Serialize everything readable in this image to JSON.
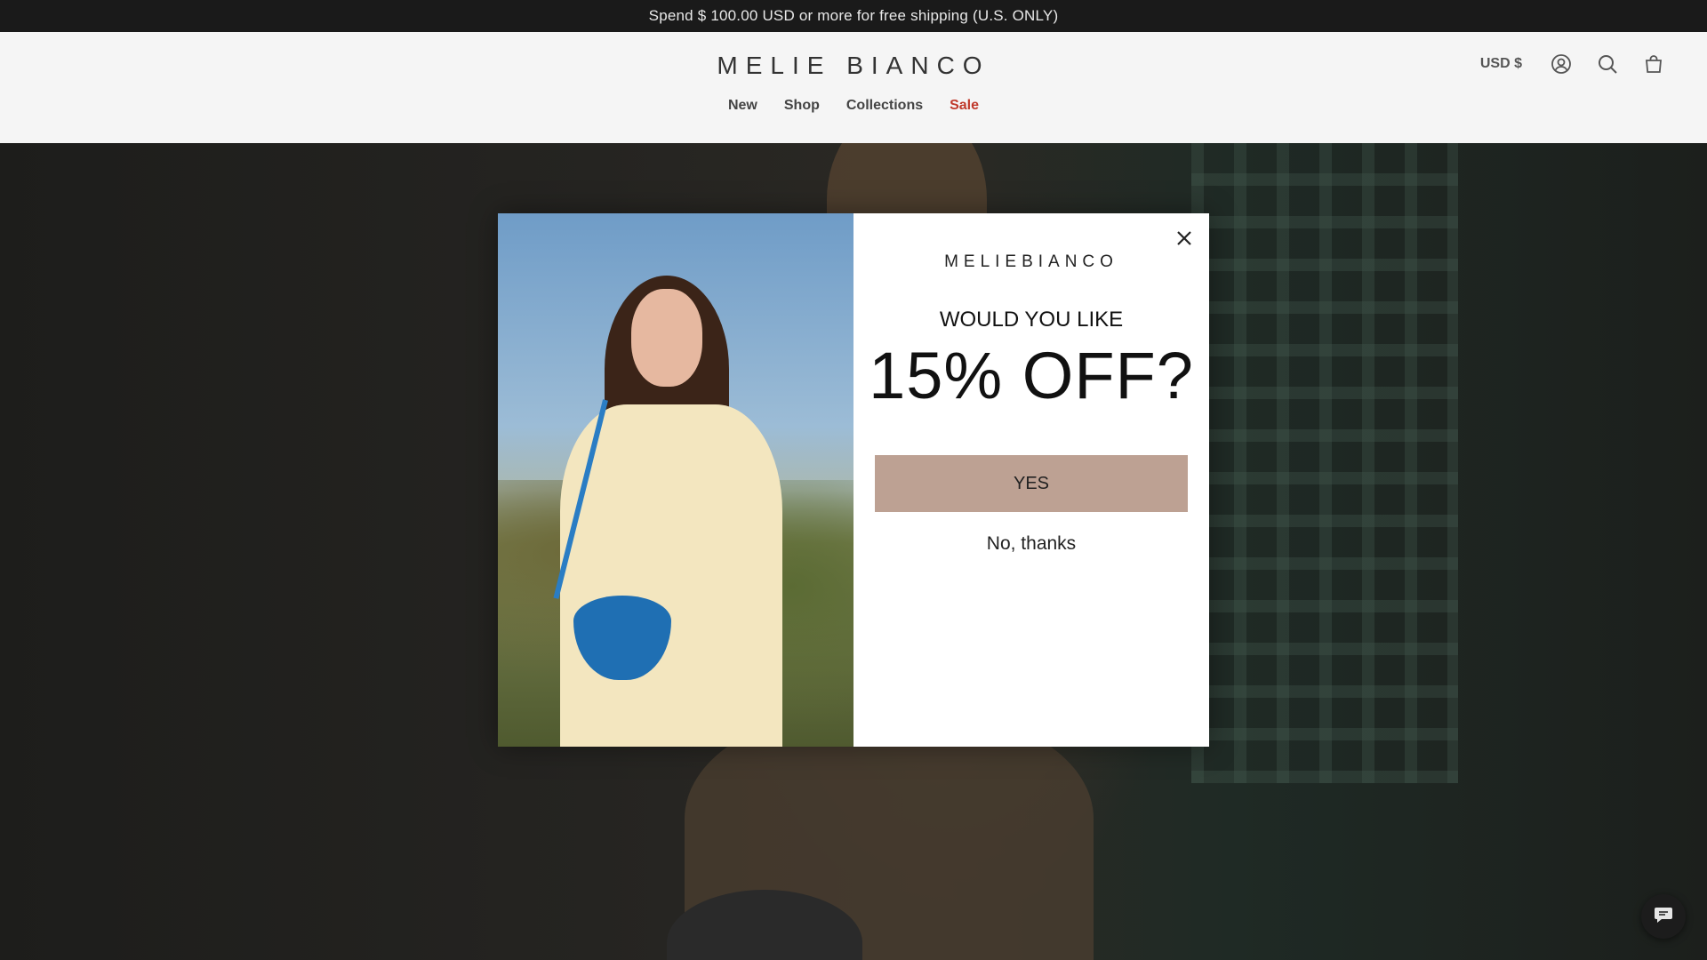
{
  "announcement": {
    "text": "Spend $ 100.00 USD or more for free shipping (U.S. ONLY)"
  },
  "header": {
    "logo": "MELIE BIANCO",
    "nav": [
      {
        "label": "New"
      },
      {
        "label": "Shop"
      },
      {
        "label": "Collections"
      },
      {
        "label": "Sale"
      }
    ],
    "currency": "USD $",
    "icons": [
      "account-icon",
      "search-icon",
      "cart-icon"
    ]
  },
  "popup": {
    "brand": "MELIEBIANCO",
    "pre_heading": "WOULD YOU LIKE",
    "heading": "15% OFF?",
    "yes_label": "YES",
    "no_label": "No, thanks",
    "close_icon": "close-icon",
    "yes_color": "#bda193"
  },
  "chat": {
    "icon": "chat-icon"
  }
}
